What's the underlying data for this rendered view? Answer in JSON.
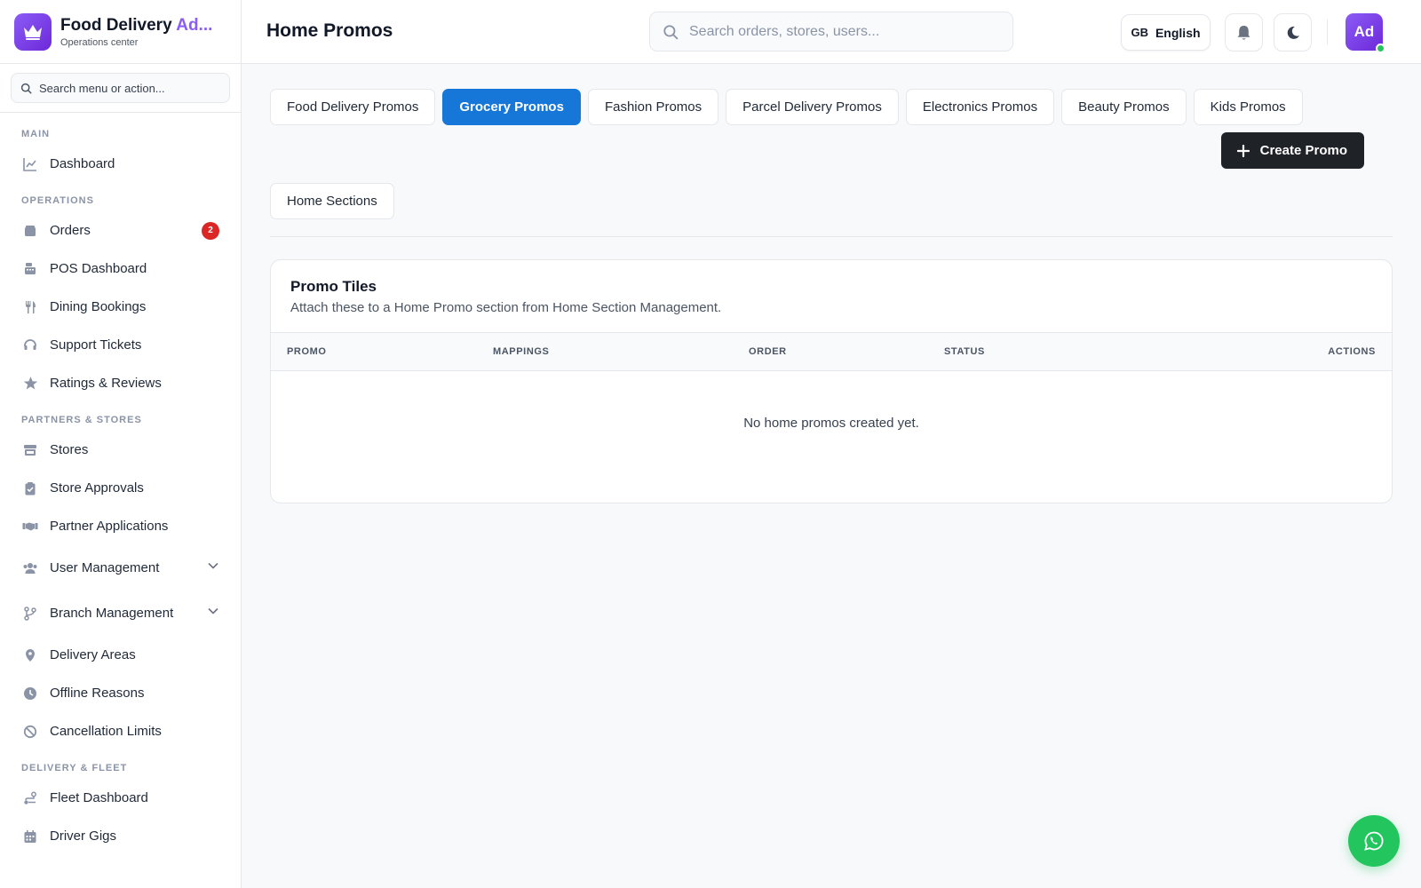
{
  "brand": {
    "title_main": "Food Delivery ",
    "title_accent": "Ad...",
    "subtitle": "Operations center"
  },
  "sidebar": {
    "search_placeholder": "Search menu or action...",
    "sections": {
      "main": "MAIN",
      "operations": "OPERATIONS",
      "partners": "PARTNERS & STORES",
      "delivery": "DELIVERY & FLEET"
    },
    "items": {
      "dashboard": "Dashboard",
      "orders": "Orders",
      "orders_badge": "2",
      "pos_dashboard": "POS Dashboard",
      "dining_bookings": "Dining Bookings",
      "support_tickets": "Support Tickets",
      "ratings_reviews": "Ratings & Reviews",
      "stores": "Stores",
      "store_approvals": "Store Approvals",
      "partner_applications": "Partner Applications",
      "user_management": "User Management",
      "branch_management": "Branch Management",
      "delivery_areas": "Delivery Areas",
      "offline_reasons": "Offline Reasons",
      "cancellation_limits": "Cancellation Limits",
      "fleet_dashboard": "Fleet Dashboard",
      "driver_gigs": "Driver Gigs"
    }
  },
  "header": {
    "title": "Home Promos",
    "search_placeholder": "Search orders, stores, users...",
    "lang_code": "GB",
    "lang_label": "English",
    "avatar_initials": "Ad"
  },
  "main": {
    "tabs": [
      {
        "label": "Food Delivery Promos",
        "active": false
      },
      {
        "label": "Grocery Promos",
        "active": true
      },
      {
        "label": "Fashion Promos",
        "active": false
      },
      {
        "label": "Parcel Delivery Promos",
        "active": false
      },
      {
        "label": "Electronics Promos",
        "active": false
      },
      {
        "label": "Beauty Promos",
        "active": false
      },
      {
        "label": "Kids Promos",
        "active": false
      }
    ],
    "create_button": "Create Promo",
    "home_sections_button": "Home Sections",
    "card": {
      "title": "Promo Tiles",
      "subtitle": "Attach these to a Home Promo section from Home Section Management.",
      "columns": [
        "PROMO",
        "MAPPINGS",
        "ORDER",
        "STATUS",
        "ACTIONS"
      ],
      "empty_message": "No home promos created yet."
    }
  },
  "colors": {
    "accent": "#8b5cf6",
    "active_tab": "#1677d9",
    "primary_dark": "#1f2328",
    "badge": "#dc2626",
    "whatsapp": "#22c55e"
  },
  "icons": {
    "brand": "crown-icon",
    "whatsapp": "whatsapp-icon",
    "notifications": "bell-icon",
    "theme": "moon-icon"
  }
}
